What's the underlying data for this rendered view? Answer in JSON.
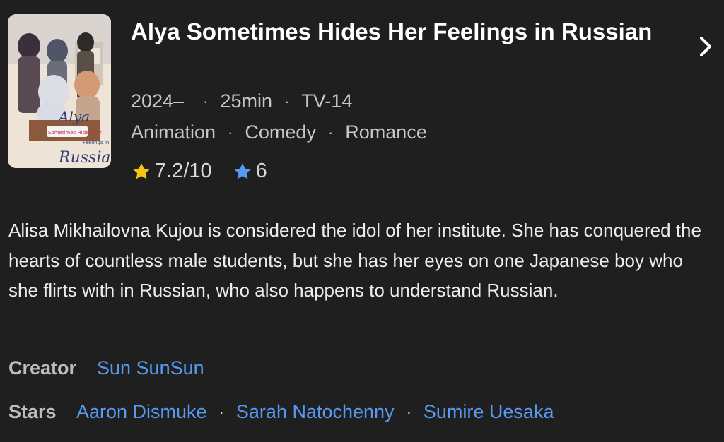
{
  "title": "Alya Sometimes Hides Her Feelings in Russian",
  "meta": {
    "year": "2024–",
    "runtime": "25min",
    "certificate": "TV-14",
    "separator": "·"
  },
  "genres": [
    "Animation",
    "Comedy",
    "Romance"
  ],
  "poster": {
    "logo_text_1": "Alya",
    "logo_text_2": "Sometimes Hides Her",
    "logo_text_3": "Feelings in",
    "logo_text_4": "Russian"
  },
  "ratings": {
    "imdb": "7.2/10",
    "user": "6",
    "imdb_star_color": "#f5c518",
    "user_star_color": "#5799ef"
  },
  "plot": "Alisa Mikhailovna Kujou is considered the idol of her institute. She has conquered the hearts of countless male students, but she has her eyes on one Japanese boy who she flirts with in Russian, who also happens to understand Russian.",
  "credits": {
    "creator_label": "Creator",
    "creators": [
      "Sun SunSun"
    ],
    "stars_label": "Stars",
    "stars": [
      "Aaron Dismuke",
      "Sarah Natochenny",
      "Sumire Uesaka"
    ]
  },
  "colors": {
    "background": "#1f1f1f",
    "link": "#5799ef",
    "muted_text": "#c6c6c6"
  },
  "icons": {
    "chevron": "chevron-right-icon",
    "imdb_star": "star-filled-icon",
    "user_star": "star-filled-icon"
  }
}
